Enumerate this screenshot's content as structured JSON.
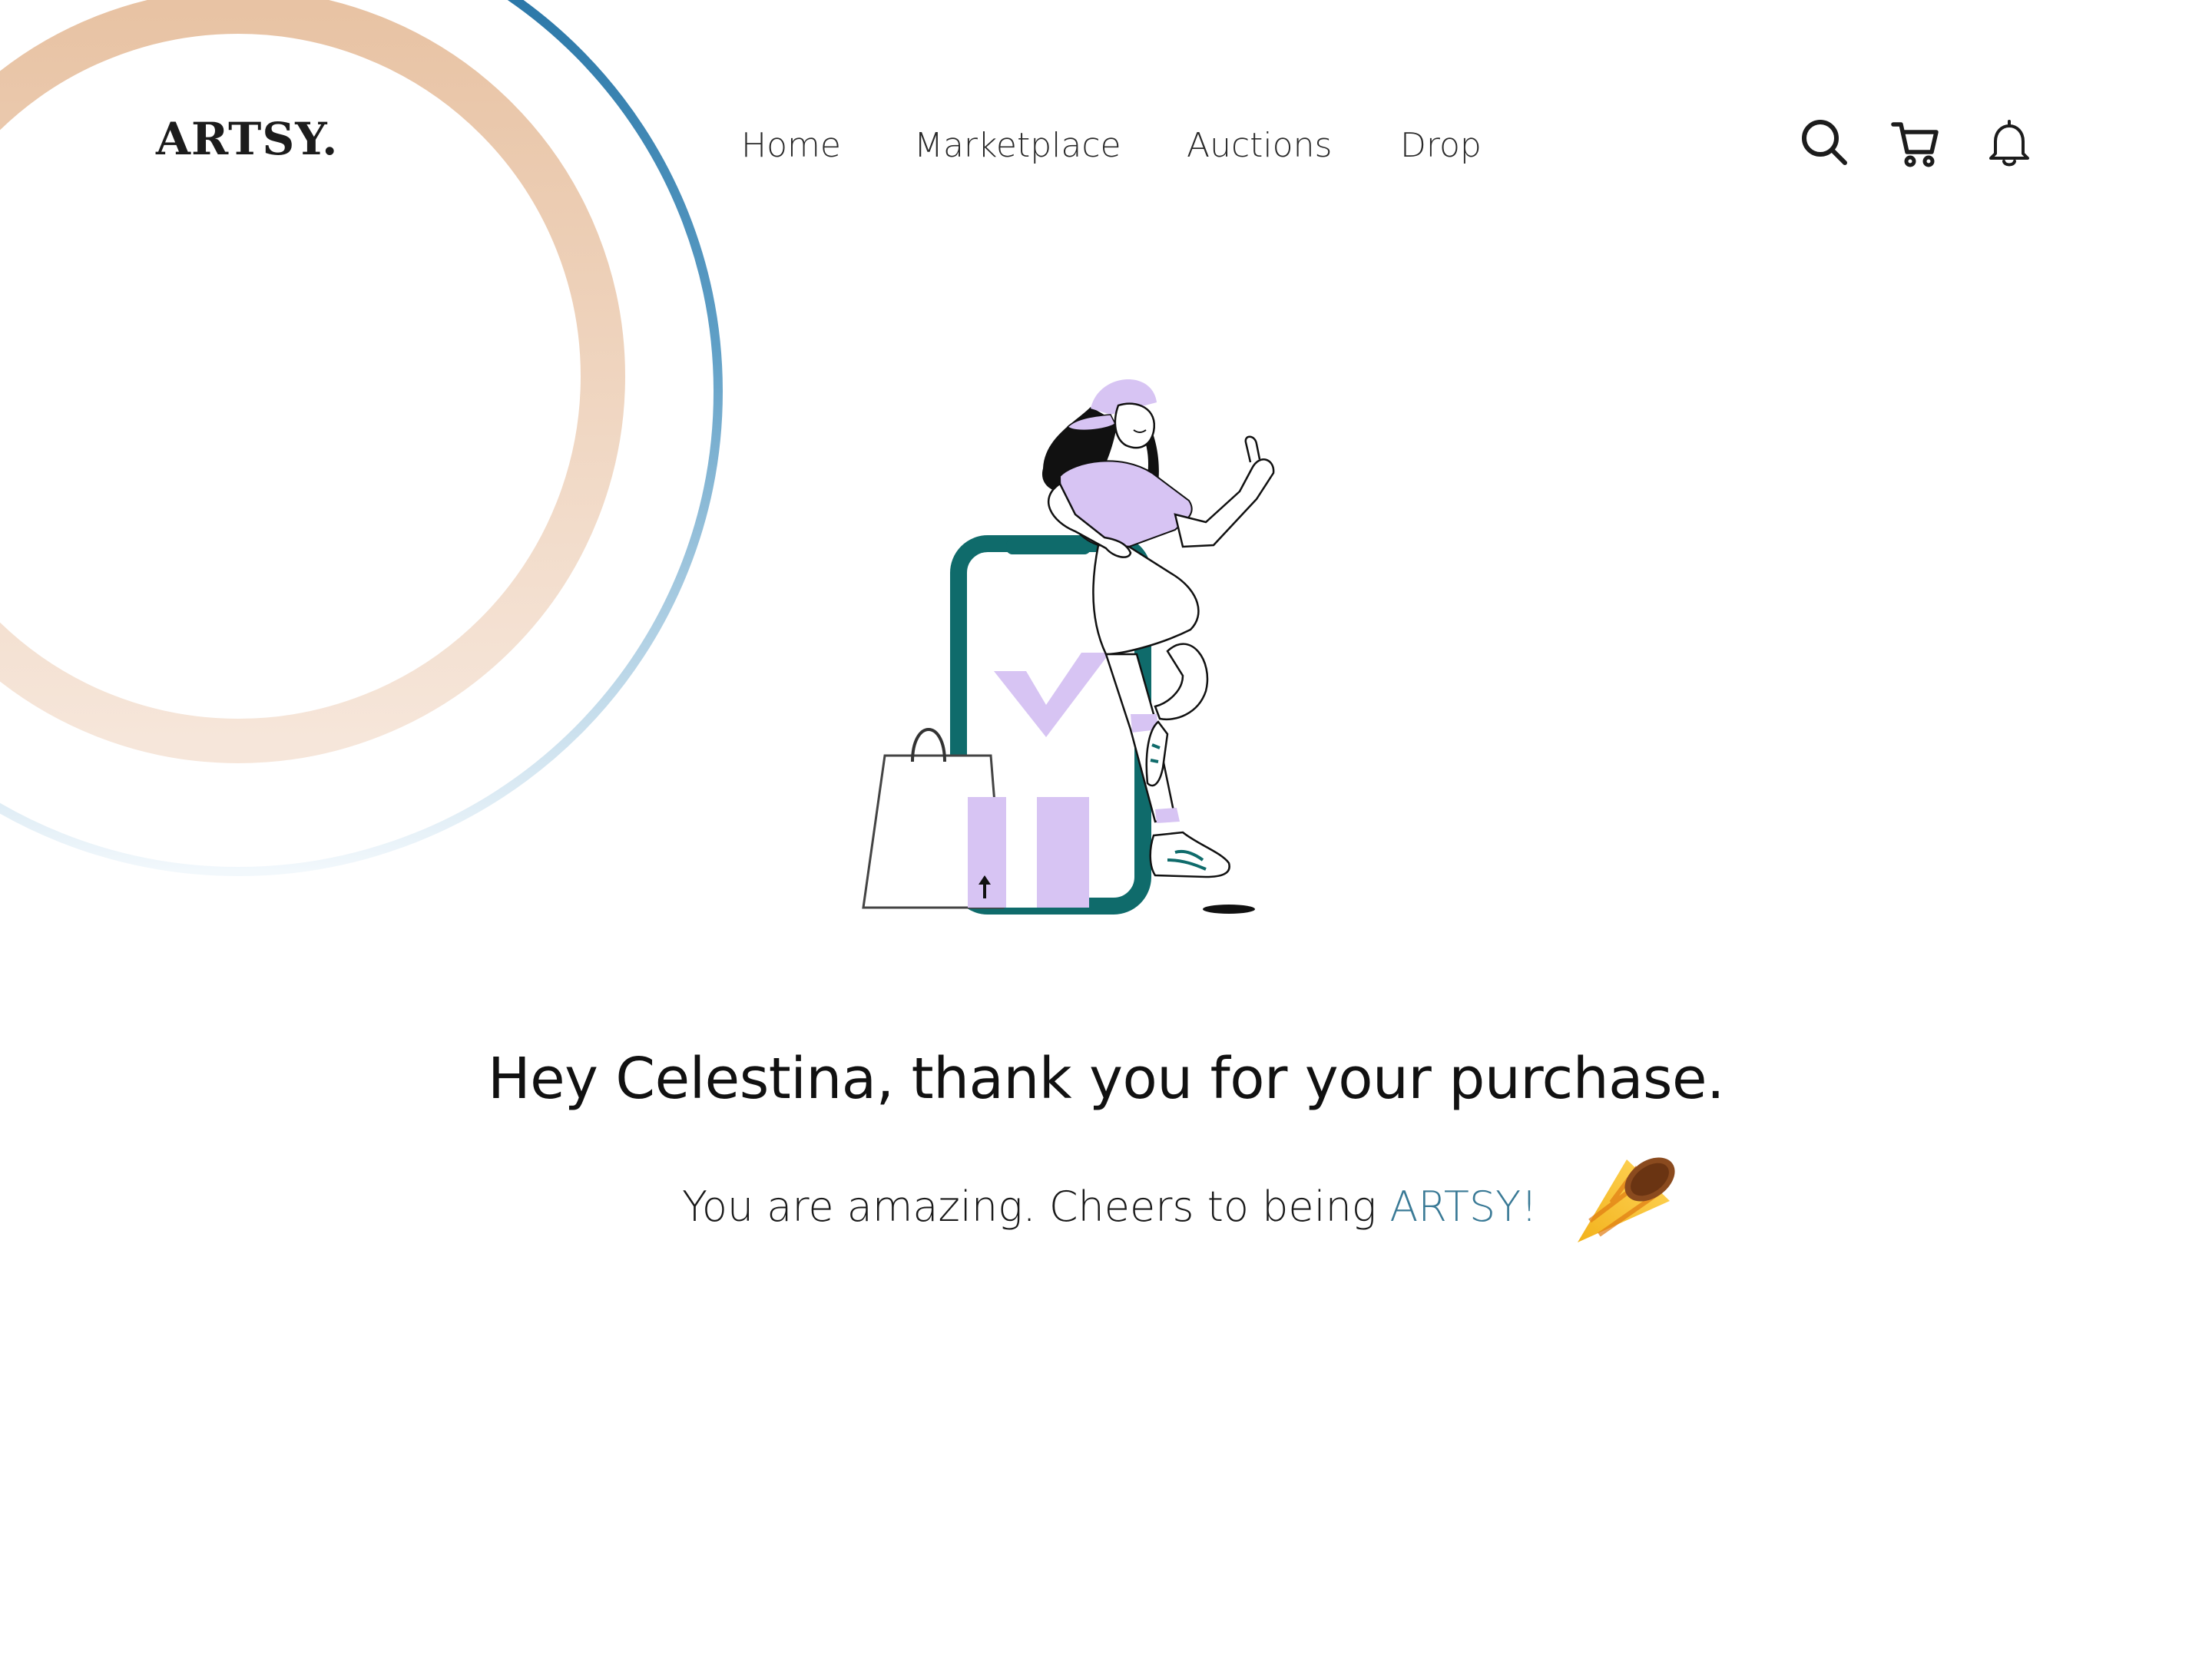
{
  "brand": {
    "logo": "ARTSY."
  },
  "nav": {
    "items": [
      {
        "label": "Home"
      },
      {
        "label": "Marketplace"
      },
      {
        "label": "Auctions"
      },
      {
        "label": "Drop"
      }
    ],
    "icons": [
      "search-icon",
      "cart-icon",
      "bell-icon"
    ]
  },
  "message": {
    "headline": "Hey Celestina, thank you for your purchase.",
    "subline_prefix": "You are amazing. Cheers to being ",
    "subline_brand": "ARTSY!",
    "emoji_icon": "party-popper-icon"
  },
  "colors": {
    "brand_teal": "#3a7a96",
    "ring_peach": "#e8c3a4",
    "ring_blue": "#2a78a8",
    "phone_teal": "#0f6b6b",
    "lavender": "#d7c4f3"
  }
}
